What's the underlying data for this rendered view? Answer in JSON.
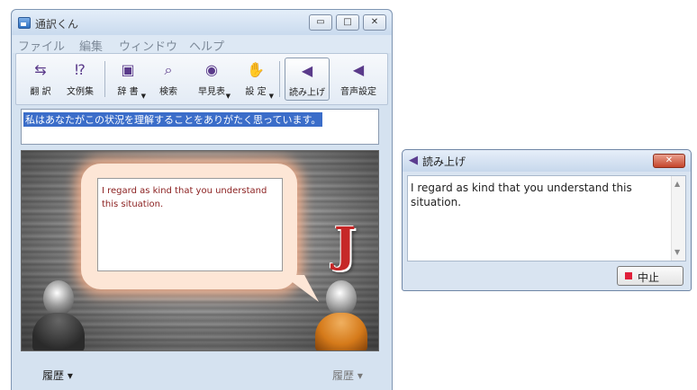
{
  "main_window": {
    "title": "通訳くん",
    "controls": {
      "minimize": "▭",
      "maximize": "□",
      "close": "✕"
    },
    "menu": [
      "ファイル",
      "編集",
      "ウィンドウ",
      "ヘルプ"
    ],
    "toolbar": [
      {
        "label": "翻 訳",
        "icon": "translate-icon",
        "glyph": "⇆"
      },
      {
        "label": "文例集",
        "icon": "phrasebook-icon",
        "glyph": "⁉"
      },
      {
        "label": "辞 書",
        "icon": "dictionary-icon",
        "glyph": "▣"
      },
      {
        "label": "検索",
        "icon": "search-icon",
        "glyph": "⌕"
      },
      {
        "label": "早見表",
        "icon": "quick-reference-icon",
        "glyph": "◉"
      },
      {
        "label": "設 定",
        "icon": "settings-icon",
        "glyph": "✋"
      },
      {
        "label": "読み上げ",
        "icon": "speaker-icon",
        "glyph": "◀"
      },
      {
        "label": "音声設定",
        "icon": "voice-settings-icon",
        "glyph": "◀"
      }
    ],
    "input_text": "私はあなたがこの状況を理解することをありがたく思っています。",
    "translation_text": "I regard as kind that you understand this situation.",
    "character_letter": "J",
    "history_left": "履歴 ▾",
    "history_right": "履歴 ▾"
  },
  "read_window": {
    "title": "読み上げ",
    "close": "✕",
    "text": "I regard as kind that you understand this situation.",
    "stop_label": "中止"
  },
  "colors": {
    "selection": "#3b6dc9",
    "translation_text": "#8a1e1e",
    "stop_mark": "#e0203a"
  }
}
